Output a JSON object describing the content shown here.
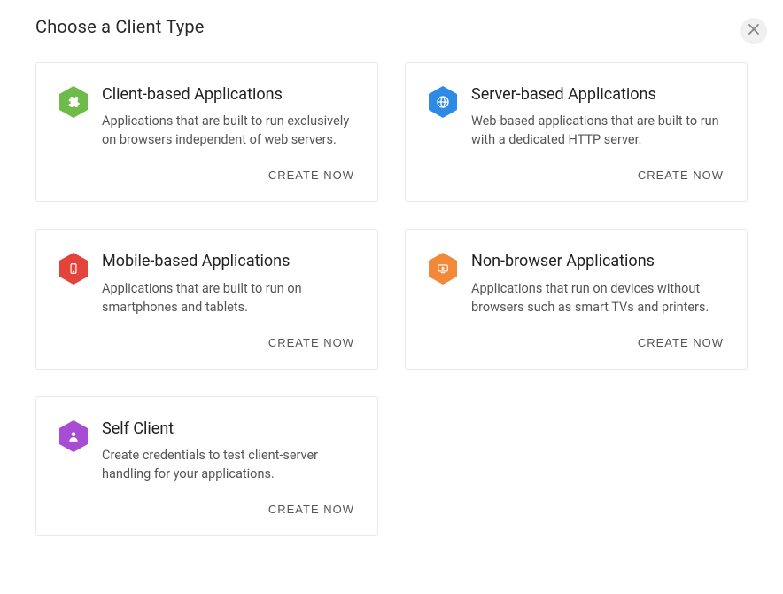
{
  "title": "Choose a Client Type",
  "actionLabel": "CREATE NOW",
  "cards": [
    {
      "title": "Client-based Applications",
      "desc": "Applications that are built to run exclusively on browsers independent of web servers.",
      "color": "#6fbb4a",
      "iconName": "puzzle-icon"
    },
    {
      "title": "Server-based Applications",
      "desc": "Web-based applications that are built to run with a dedicated HTTP server.",
      "color": "#2f8ae5",
      "iconName": "globe-icon"
    },
    {
      "title": "Mobile-based Applications",
      "desc": "Applications that are built to run on smartphones and tablets.",
      "color": "#e2443c",
      "iconName": "mobile-icon"
    },
    {
      "title": "Non-browser Applications",
      "desc": "Applications that run on devices without browsers such as smart TVs and printers.",
      "color": "#f0893a",
      "iconName": "tv-icon"
    },
    {
      "title": "Self Client",
      "desc": "Create credentials to test client-server handling for your applications.",
      "color": "#a94cd4",
      "iconName": "person-icon"
    }
  ]
}
